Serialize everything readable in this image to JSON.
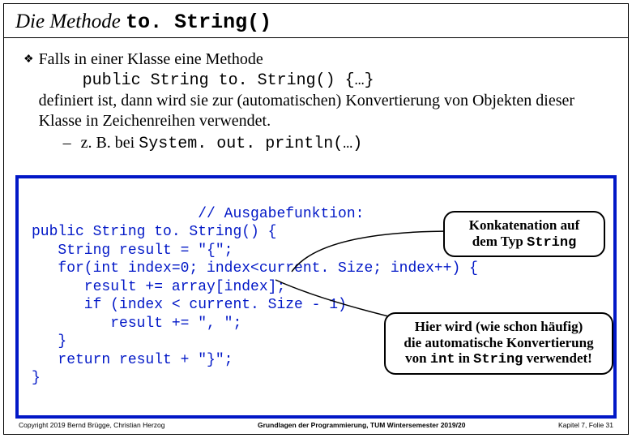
{
  "title": {
    "pre": "Die Methode ",
    "code": "to. String()"
  },
  "bullet": {
    "line1": "Falls in einer Klasse eine Methode",
    "code1": "public String to. String() {…}",
    "line2": "definiert ist, dann wird sie zur (automatischen) Konvertierung von Objekten dieser Klasse in Zeichenreihen verwendet.",
    "sub_pre": "z. B. bei  ",
    "sub_code": "System. out. println(…)"
  },
  "code": {
    "c0": "                   // Ausgabefunktion:",
    "l1": "public String to. String() {",
    "l2": "   String result = \"{\";",
    "l3": "   for(int index=0; index<current. Size; index++) {",
    "l4": "      result += array[index];",
    "l5": "      if (index < current. Size - 1)",
    "l6": "         result += \", \";",
    "l7": "   }",
    "l8": "   return result + \"}\";",
    "l9": "}"
  },
  "callout1": {
    "t1": "Konkatenation auf",
    "t2": "dem Typ ",
    "t2code": "String"
  },
  "callout2": {
    "t1": "Hier wird (wie schon häufig)",
    "t2": "die automatische Konvertierung",
    "t3_a": "von ",
    "t3_b": "int",
    "t3_c": " in ",
    "t3_d": "String",
    "t3_e": " verwendet!"
  },
  "footer": {
    "left": "Copyright 2019 Bernd Brügge, Christian Herzog",
    "mid": "Grundlagen der Programmierung, TUM Wintersemester 2019/20",
    "right": "Kapitel 7, Folie 31"
  }
}
